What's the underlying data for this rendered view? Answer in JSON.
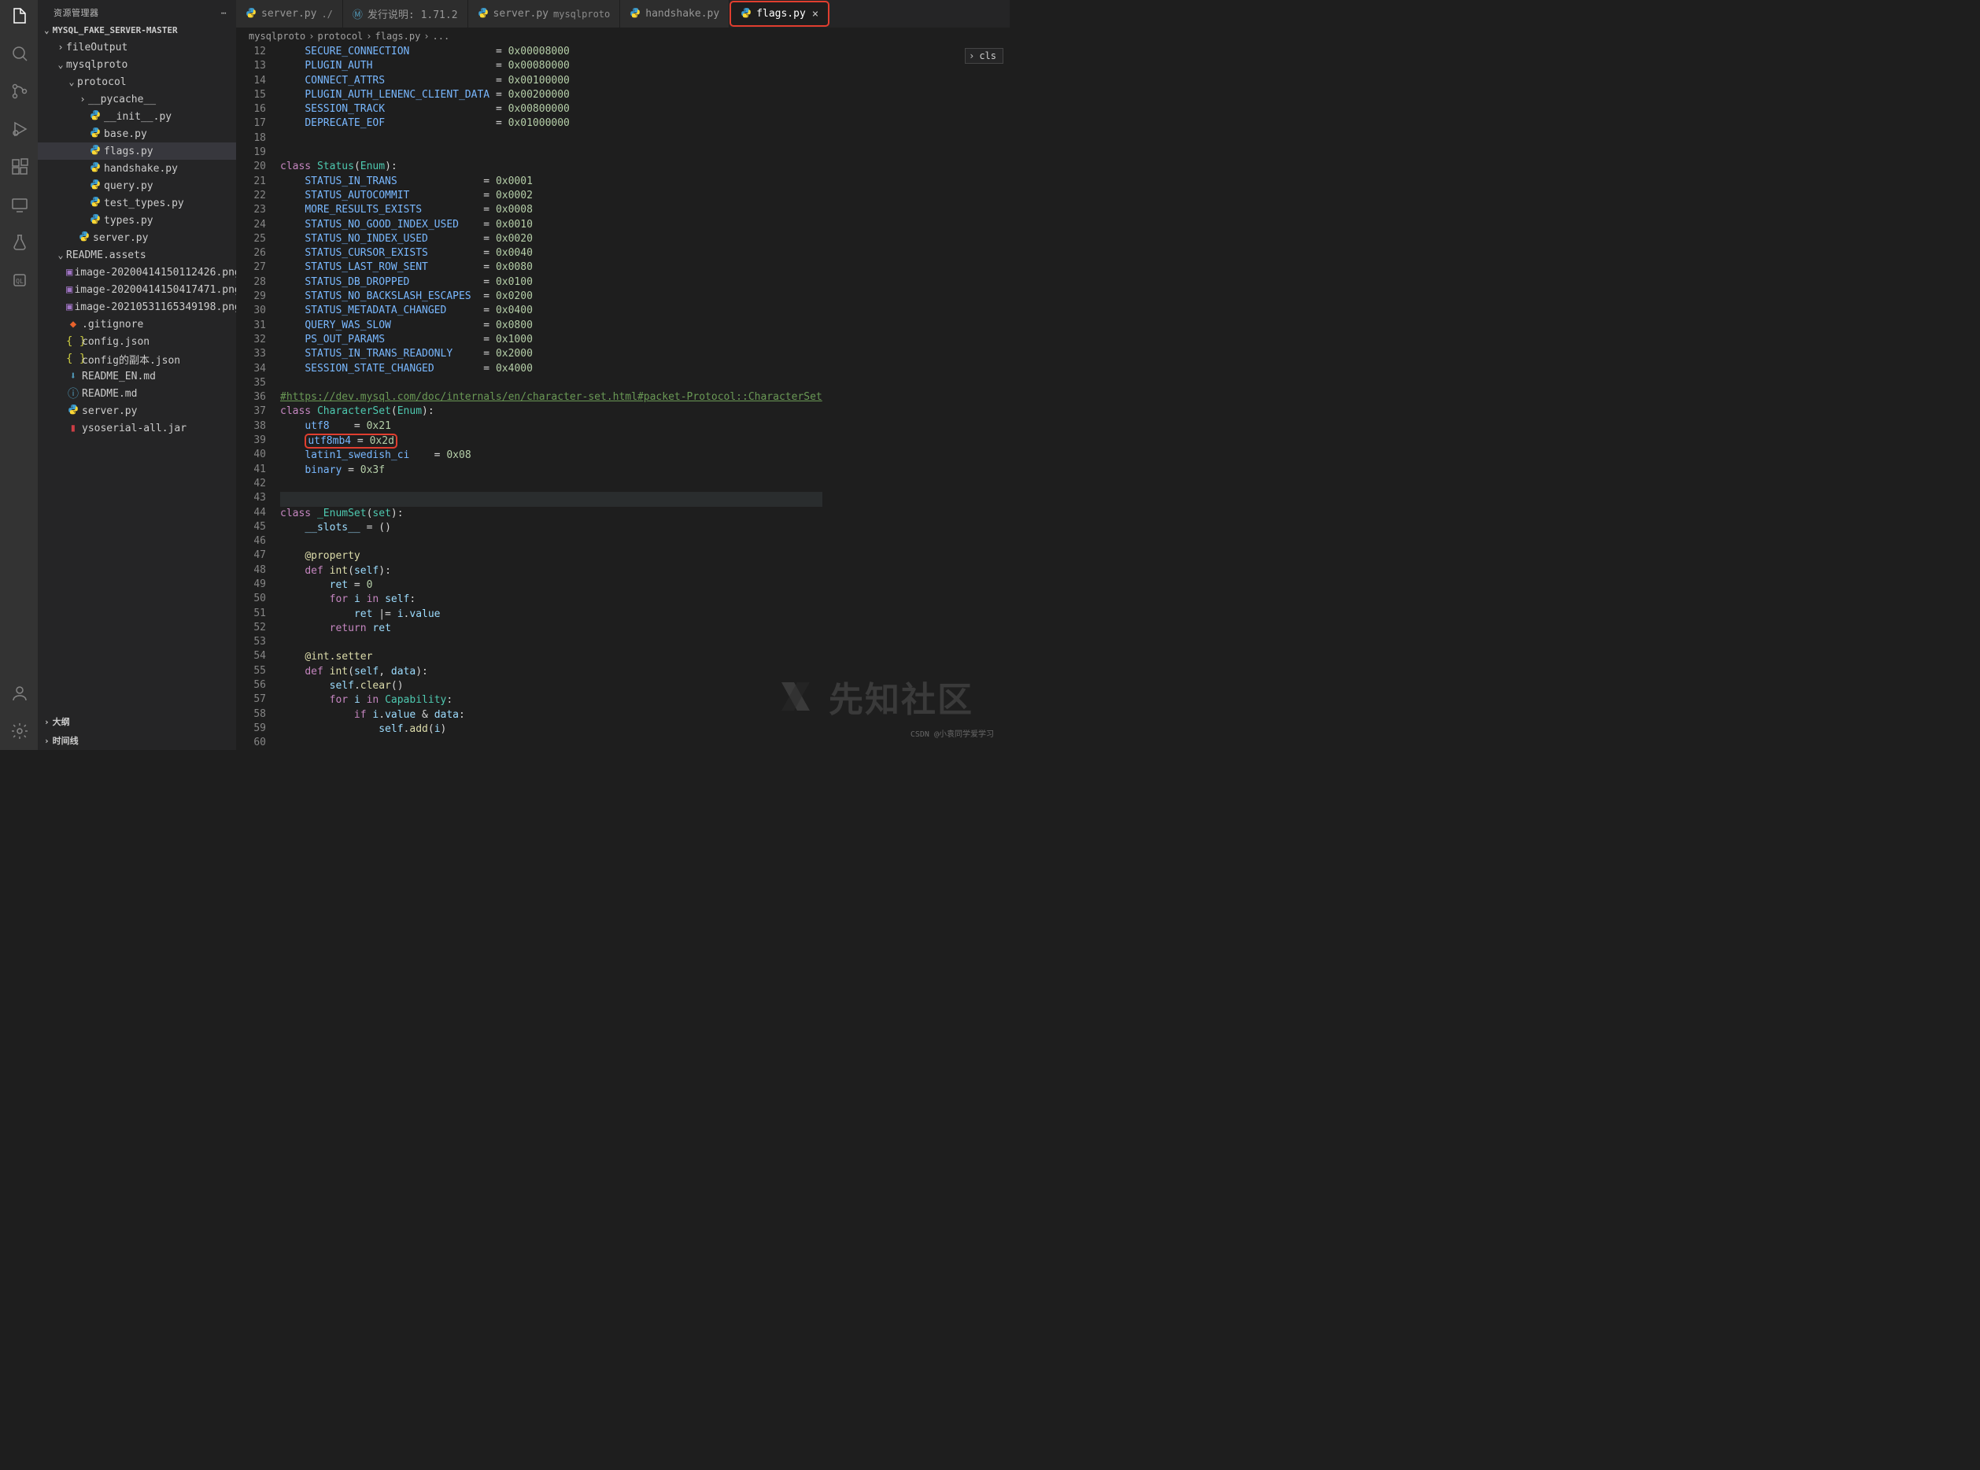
{
  "activityIcons": [
    "files",
    "search",
    "scm",
    "debug",
    "extensions",
    "remote",
    "testing",
    "sql"
  ],
  "sideHeader": "资源管理器",
  "projectName": "MYSQL_FAKE_SERVER-MASTER",
  "tree": [
    {
      "depth": 1,
      "type": "dir",
      "open": false,
      "name": "fileOutput"
    },
    {
      "depth": 1,
      "type": "dir",
      "open": true,
      "name": "mysqlproto"
    },
    {
      "depth": 2,
      "type": "dir",
      "open": true,
      "name": "protocol"
    },
    {
      "depth": 3,
      "type": "dir",
      "open": false,
      "name": "__pycache__"
    },
    {
      "depth": 3,
      "type": "py",
      "name": "__init__.py"
    },
    {
      "depth": 3,
      "type": "py",
      "name": "base.py"
    },
    {
      "depth": 3,
      "type": "py",
      "name": "flags.py",
      "sel": true
    },
    {
      "depth": 3,
      "type": "py",
      "name": "handshake.py"
    },
    {
      "depth": 3,
      "type": "py",
      "name": "query.py"
    },
    {
      "depth": 3,
      "type": "py",
      "name": "test_types.py"
    },
    {
      "depth": 3,
      "type": "py",
      "name": "types.py"
    },
    {
      "depth": 2,
      "type": "py",
      "name": "server.py"
    },
    {
      "depth": 1,
      "type": "dir",
      "open": true,
      "name": "README.assets"
    },
    {
      "depth": 2,
      "type": "img",
      "name": "image-20200414150112426.png"
    },
    {
      "depth": 2,
      "type": "img",
      "name": "image-20200414150417471.png"
    },
    {
      "depth": 2,
      "type": "img",
      "name": "image-20210531165349198.png"
    },
    {
      "depth": 1,
      "type": "git",
      "name": ".gitignore"
    },
    {
      "depth": 1,
      "type": "json",
      "name": "config.json"
    },
    {
      "depth": 1,
      "type": "json",
      "name": "config的副本.json"
    },
    {
      "depth": 1,
      "type": "md",
      "name": "README_EN.md"
    },
    {
      "depth": 1,
      "type": "info",
      "name": "README.md"
    },
    {
      "depth": 1,
      "type": "py",
      "name": "server.py"
    },
    {
      "depth": 1,
      "type": "jar",
      "name": "ysoserial-all.jar"
    }
  ],
  "bottomSections": [
    "大纲",
    "时间线"
  ],
  "tabs": [
    {
      "icon": "py",
      "label": "server.py",
      "sub": "./"
    },
    {
      "icon": "md",
      "label": "发行说明: 1.71.2"
    },
    {
      "icon": "py",
      "label": "server.py",
      "sub": "mysqlproto"
    },
    {
      "icon": "py",
      "label": "handshake.py"
    },
    {
      "icon": "py",
      "label": "flags.py",
      "active": true,
      "close": true,
      "hl": true
    }
  ],
  "breadcrumb": [
    "mysqlproto",
    "protocol",
    "flags.py",
    "..."
  ],
  "clsPopup": "cls",
  "code": {
    "start": 12,
    "lines": [
      [
        [
          "    "
        ],
        [
          "attr",
          "SECURE_CONNECTION"
        ],
        [
          "              = "
        ],
        [
          "num",
          "0x00008000"
        ]
      ],
      [
        [
          "    "
        ],
        [
          "attr",
          "PLUGIN_AUTH"
        ],
        [
          "                    = "
        ],
        [
          "num",
          "0x00080000"
        ]
      ],
      [
        [
          "    "
        ],
        [
          "attr",
          "CONNECT_ATTRS"
        ],
        [
          "                  = "
        ],
        [
          "num",
          "0x00100000"
        ]
      ],
      [
        [
          "    "
        ],
        [
          "attr",
          "PLUGIN_AUTH_LENENC_CLIENT_DATA"
        ],
        [
          " = "
        ],
        [
          "num",
          "0x00200000"
        ]
      ],
      [
        [
          "    "
        ],
        [
          "attr",
          "SESSION_TRACK"
        ],
        [
          "                  = "
        ],
        [
          "num",
          "0x00800000"
        ]
      ],
      [
        [
          "    "
        ],
        [
          "attr",
          "DEPRECATE_EOF"
        ],
        [
          "                  = "
        ],
        [
          "num",
          "0x01000000"
        ]
      ],
      [
        [
          ""
        ]
      ],
      [
        [
          ""
        ]
      ],
      [
        [
          "kw",
          "class"
        ],
        [
          " "
        ],
        [
          "cls",
          "Status"
        ],
        [
          "pn",
          "("
        ],
        [
          "cls",
          "Enum"
        ],
        [
          "pn",
          ")"
        ],
        [
          "pn",
          ":"
        ]
      ],
      [
        [
          "    "
        ],
        [
          "attr",
          "STATUS_IN_TRANS"
        ],
        [
          "              = "
        ],
        [
          "num",
          "0x0001"
        ]
      ],
      [
        [
          "    "
        ],
        [
          "attr",
          "STATUS_AUTOCOMMIT"
        ],
        [
          "            = "
        ],
        [
          "num",
          "0x0002"
        ]
      ],
      [
        [
          "    "
        ],
        [
          "attr",
          "MORE_RESULTS_EXISTS"
        ],
        [
          "          = "
        ],
        [
          "num",
          "0x0008"
        ]
      ],
      [
        [
          "    "
        ],
        [
          "attr",
          "STATUS_NO_GOOD_INDEX_USED"
        ],
        [
          "    = "
        ],
        [
          "num",
          "0x0010"
        ]
      ],
      [
        [
          "    "
        ],
        [
          "attr",
          "STATUS_NO_INDEX_USED"
        ],
        [
          "         = "
        ],
        [
          "num",
          "0x0020"
        ]
      ],
      [
        [
          "    "
        ],
        [
          "attr",
          "STATUS_CURSOR_EXISTS"
        ],
        [
          "         = "
        ],
        [
          "num",
          "0x0040"
        ]
      ],
      [
        [
          "    "
        ],
        [
          "attr",
          "STATUS_LAST_ROW_SENT"
        ],
        [
          "         = "
        ],
        [
          "num",
          "0x0080"
        ]
      ],
      [
        [
          "    "
        ],
        [
          "attr",
          "STATUS_DB_DROPPED"
        ],
        [
          "            = "
        ],
        [
          "num",
          "0x0100"
        ]
      ],
      [
        [
          "    "
        ],
        [
          "attr",
          "STATUS_NO_BACKSLASH_ESCAPES"
        ],
        [
          "  = "
        ],
        [
          "num",
          "0x0200"
        ]
      ],
      [
        [
          "    "
        ],
        [
          "attr",
          "STATUS_METADATA_CHANGED"
        ],
        [
          "      = "
        ],
        [
          "num",
          "0x0400"
        ]
      ],
      [
        [
          "    "
        ],
        [
          "attr",
          "QUERY_WAS_SLOW"
        ],
        [
          "               = "
        ],
        [
          "num",
          "0x0800"
        ]
      ],
      [
        [
          "    "
        ],
        [
          "attr",
          "PS_OUT_PARAMS"
        ],
        [
          "                = "
        ],
        [
          "num",
          "0x1000"
        ]
      ],
      [
        [
          "    "
        ],
        [
          "attr",
          "STATUS_IN_TRANS_READONLY"
        ],
        [
          "     = "
        ],
        [
          "num",
          "0x2000"
        ]
      ],
      [
        [
          "    "
        ],
        [
          "attr",
          "SESSION_STATE_CHANGED"
        ],
        [
          "        = "
        ],
        [
          "num",
          "0x4000"
        ]
      ],
      [
        [
          ""
        ]
      ],
      [
        [
          "cmt",
          "#https://dev.mysql.com/doc/internals/en/character-set.html#packet-Protocol::CharacterSet"
        ]
      ],
      [
        [
          "kw",
          "class"
        ],
        [
          " "
        ],
        [
          "cls",
          "CharacterSet"
        ],
        [
          "pn",
          "("
        ],
        [
          "cls",
          "Enum"
        ],
        [
          "pn",
          ")"
        ],
        [
          "pn",
          ":"
        ]
      ],
      [
        [
          "    "
        ],
        [
          "attr",
          "utf8"
        ],
        [
          "    = "
        ],
        [
          "num",
          "0x21"
        ]
      ],
      [
        [
          "    "
        ],
        [
          "hl",
          "utf8mb4 = 0x2d"
        ]
      ],
      [
        [
          "    "
        ],
        [
          "attr",
          "latin1_swedish_ci"
        ],
        [
          "    = "
        ],
        [
          "num",
          "0x08"
        ]
      ],
      [
        [
          "    "
        ],
        [
          "attr",
          "binary"
        ],
        [
          " = "
        ],
        [
          "num",
          "0x3f"
        ]
      ],
      [
        [
          ""
        ]
      ],
      [
        [
          "",
          "",
          "current"
        ]
      ],
      [
        [
          "kw",
          "class"
        ],
        [
          " "
        ],
        [
          "cls",
          "_EnumSet"
        ],
        [
          "pn",
          "("
        ],
        [
          "cls",
          "set"
        ],
        [
          "pn",
          ")"
        ],
        [
          "pn",
          ":"
        ]
      ],
      [
        [
          "    "
        ],
        [
          "var",
          "__slots__"
        ],
        [
          " = "
        ],
        [
          "pn",
          "()"
        ]
      ],
      [
        [
          ""
        ]
      ],
      [
        [
          "    "
        ],
        [
          "dec",
          "@property"
        ]
      ],
      [
        [
          "    "
        ],
        [
          "kw",
          "def"
        ],
        [
          " "
        ],
        [
          "fn",
          "int"
        ],
        [
          "pn",
          "("
        ],
        [
          "self",
          "self"
        ],
        [
          "pn",
          ")"
        ],
        [
          "pn",
          ":"
        ]
      ],
      [
        [
          "        "
        ],
        [
          "var",
          "ret"
        ],
        [
          " = "
        ],
        [
          "num",
          "0"
        ]
      ],
      [
        [
          "        "
        ],
        [
          "kw",
          "for"
        ],
        [
          " "
        ],
        [
          "var",
          "i"
        ],
        [
          " "
        ],
        [
          "kw",
          "in"
        ],
        [
          " "
        ],
        [
          "self",
          "self"
        ],
        [
          "pn",
          ":"
        ]
      ],
      [
        [
          "            "
        ],
        [
          "var",
          "ret"
        ],
        [
          " |= "
        ],
        [
          "var",
          "i"
        ],
        [
          "."
        ],
        [
          "var",
          "value"
        ]
      ],
      [
        [
          "        "
        ],
        [
          "kw",
          "return"
        ],
        [
          " "
        ],
        [
          "var",
          "ret"
        ]
      ],
      [
        [
          ""
        ]
      ],
      [
        [
          "    "
        ],
        [
          "dec",
          "@int.setter"
        ]
      ],
      [
        [
          "    "
        ],
        [
          "kw",
          "def"
        ],
        [
          " "
        ],
        [
          "fn",
          "int"
        ],
        [
          "pn",
          "("
        ],
        [
          "self",
          "self"
        ],
        [
          ", "
        ],
        [
          "var",
          "data"
        ],
        [
          "pn",
          ")"
        ],
        [
          "pn",
          ":"
        ]
      ],
      [
        [
          "        "
        ],
        [
          "self",
          "self"
        ],
        [
          "."
        ],
        [
          "fn",
          "clear"
        ],
        [
          "pn",
          "()"
        ]
      ],
      [
        [
          "        "
        ],
        [
          "kw",
          "for"
        ],
        [
          " "
        ],
        [
          "var",
          "i"
        ],
        [
          " "
        ],
        [
          "kw",
          "in"
        ],
        [
          " "
        ],
        [
          "cls",
          "Capability"
        ],
        [
          "pn",
          ":"
        ]
      ],
      [
        [
          "            "
        ],
        [
          "kw",
          "if"
        ],
        [
          " "
        ],
        [
          "var",
          "i"
        ],
        [
          "."
        ],
        [
          "var",
          "value"
        ],
        [
          " & "
        ],
        [
          "var",
          "data"
        ],
        [
          "pn",
          ":"
        ]
      ],
      [
        [
          "                "
        ],
        [
          "self",
          "self"
        ],
        [
          "."
        ],
        [
          "fn",
          "add"
        ],
        [
          "pn",
          "("
        ],
        [
          "var",
          "i"
        ],
        [
          "pn",
          ")"
        ]
      ],
      [
        [
          ""
        ]
      ]
    ]
  },
  "watermark": {
    "logo": "先知社区",
    "credit": "CSDN @小袁同学爱学习"
  }
}
